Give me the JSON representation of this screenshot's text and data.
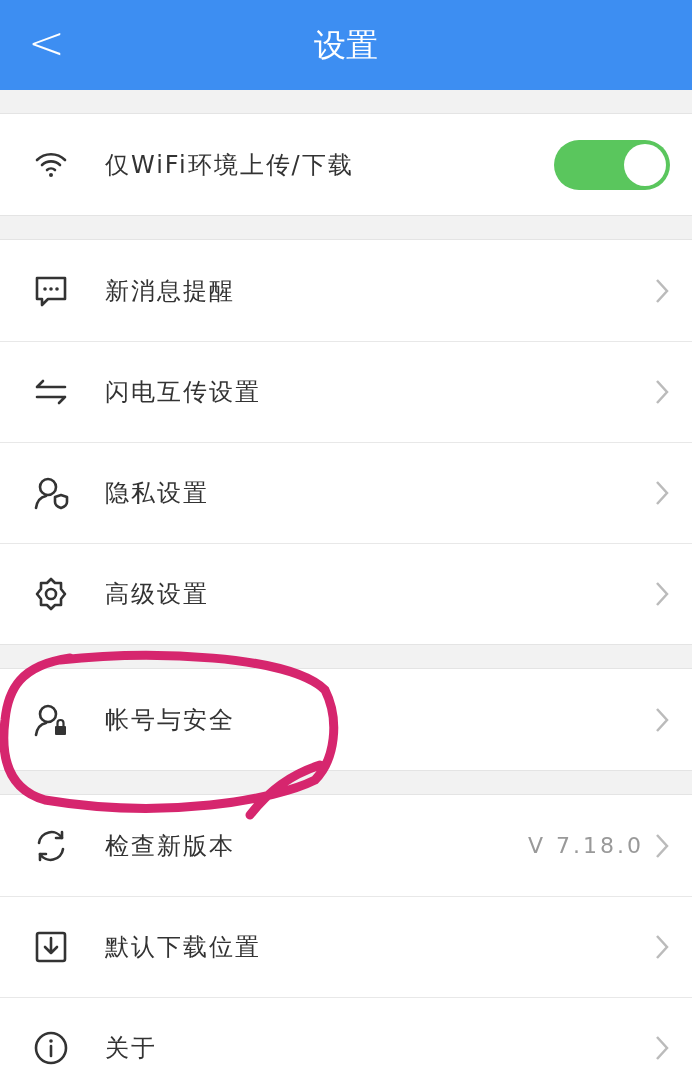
{
  "header": {
    "back": "<",
    "title": "设置"
  },
  "groups": [
    {
      "items": [
        {
          "kind": "toggle",
          "label": "仅WiFi环境上传/下载",
          "on": true
        }
      ]
    },
    {
      "items": [
        {
          "kind": "link",
          "label": "新消息提醒"
        },
        {
          "kind": "link",
          "label": "闪电互传设置"
        },
        {
          "kind": "link",
          "label": "隐私设置"
        },
        {
          "kind": "link",
          "label": "高级设置"
        }
      ]
    },
    {
      "items": [
        {
          "kind": "link",
          "label": "帐号与安全"
        }
      ]
    },
    {
      "items": [
        {
          "kind": "link",
          "label": "检查新版本",
          "value": "V 7.18.0"
        },
        {
          "kind": "link",
          "label": "默认下载位置"
        },
        {
          "kind": "link",
          "label": "关于"
        }
      ]
    }
  ]
}
